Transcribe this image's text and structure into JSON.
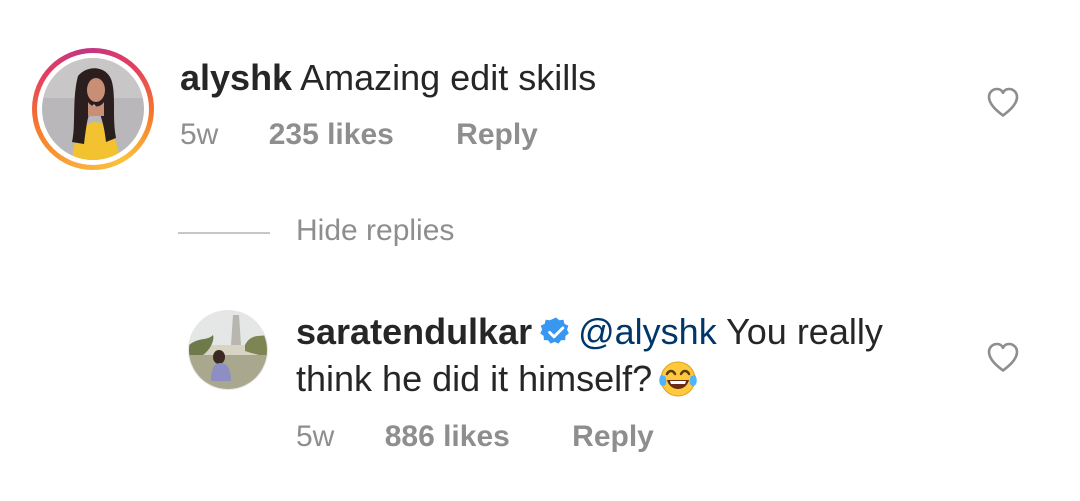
{
  "comment": {
    "username": "alyshk",
    "text": "Amazing edit skills",
    "time": "5w",
    "likes": "235 likes",
    "reply_label": "Reply"
  },
  "hide_replies_label": "Hide replies",
  "reply": {
    "username": "saratendulkar",
    "mention": "@alyshk",
    "text_line1": "You really",
    "text_line2": "think he did it himself?",
    "emoji": "face-with-tears-of-joy-icon",
    "time": "5w",
    "likes": "886 likes",
    "reply_label": "Reply"
  },
  "colors": {
    "text": "#262626",
    "secondary": "#8e8e8e",
    "mention": "#00376b",
    "verified": "#3897f0",
    "heart_outline": "#8e8e8e"
  }
}
